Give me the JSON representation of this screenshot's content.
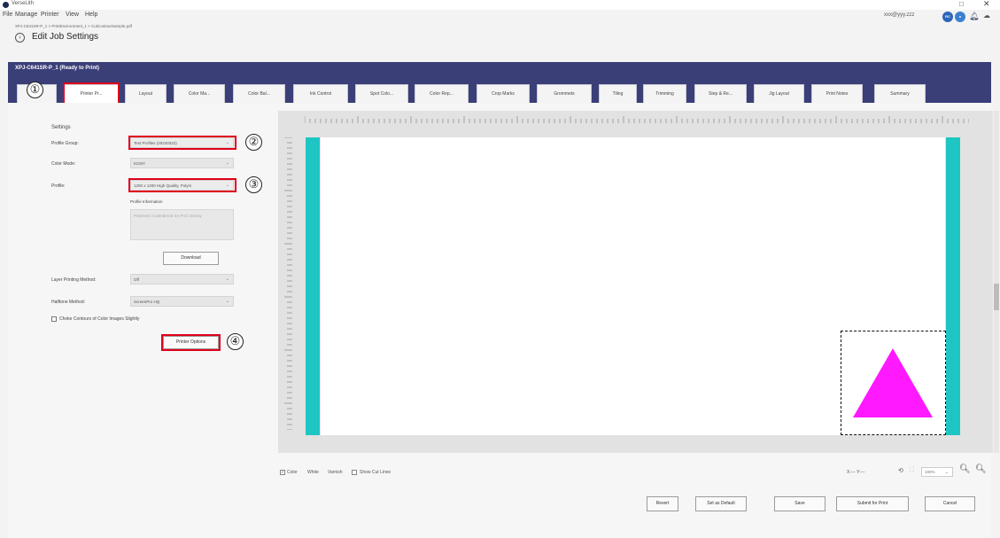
{
  "app": {
    "title": "VerseLith"
  },
  "window_controls": {
    "restore": "□",
    "close": "✕"
  },
  "menu": [
    "File",
    "Manage",
    "Printer",
    "View",
    "Help"
  ],
  "user": {
    "email": "xxx@yyy.zzz",
    "badges": [
      "RC",
      "●"
    ]
  },
  "breadcrumb": "XPJ-C641SR-P_1 > PrintEnvironment_1 > CutContourSample.pdf",
  "page_title": "Edit Job Settings",
  "printer_status": "XPJ-C641SR-P_1 (Ready to Print)",
  "tabs": [
    "Printer Pr...",
    "Layout",
    "Color Ma...",
    "Color Bal...",
    "Ink Control",
    "Spot Colo...",
    "Color Rep...",
    "Crop Marks",
    "Grommets",
    "Tiling",
    "Trimming",
    "Step & Re...",
    "Jig Layout",
    "Print Notes",
    "Summary"
  ],
  "callouts": [
    "①",
    "②",
    "③",
    "④"
  ],
  "settings": {
    "heading": "Settings",
    "profile_group_label": "Profile Group:",
    "profile_group_value": "Test Profiles (20240322)",
    "color_mode_label": "Color Mode:",
    "color_mode_value": "KCMY",
    "profile_label": "Profile:",
    "profile_value": "1200 x 1200 High Quality, Polym",
    "profile_info_label": "Profile Information",
    "profile_info_text": "Polymeric Calendered SA PVC Glossy",
    "download_button": "Download",
    "layer_method_label": "Layer Printing Method:",
    "layer_method_value": "Off",
    "halftone_label": "Halftone Method:",
    "halftone_value": "ScreenPro HQ",
    "choke_label": "Choke Contours of Color Images Slightly",
    "printer_options_button": "Printer Options"
  },
  "preview": {
    "options": {
      "color": "Color",
      "white": "White",
      "varnish": "Varnish",
      "show_cut_lines": "Show Cut Lines"
    },
    "coords": "X:--- Y:---",
    "zoom": "100%",
    "colors": {
      "teal": "#1ec6c3",
      "magenta": "#ff19ff"
    }
  },
  "footer": {
    "revert": "Revert",
    "set_default": "Set as Default",
    "save": "Save",
    "submit": "Submit for Print",
    "cancel": "Cancel"
  },
  "colors": {
    "header": "#3b3f78",
    "annotation": "#e0001b"
  }
}
